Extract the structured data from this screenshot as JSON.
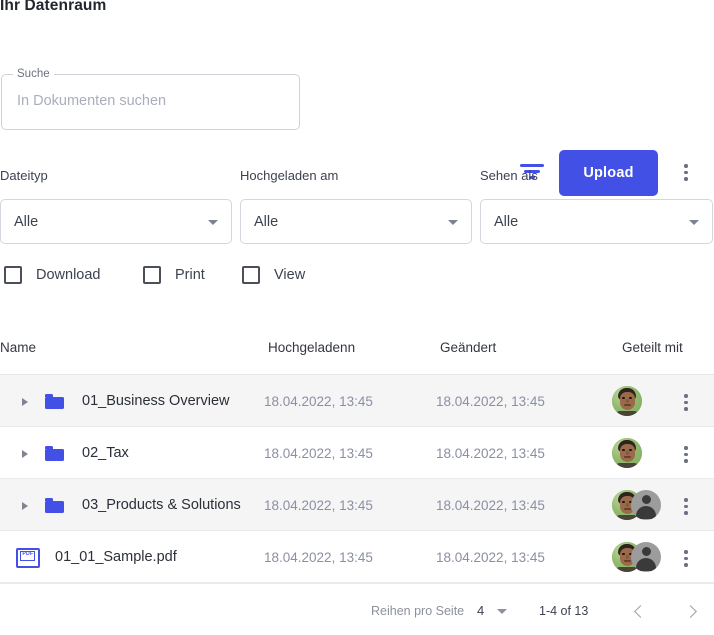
{
  "header": {
    "title": "Ihr Datenraum"
  },
  "search": {
    "label": "Suche",
    "placeholder": "In Dokumenten suchen",
    "value": ""
  },
  "toolbar": {
    "filter_icon": "filter-icon",
    "upload_label": "Upload",
    "more_icon": "kebab-menu-icon",
    "accent_color": "#4350e6"
  },
  "filters": [
    {
      "label": "Dateityp",
      "value": "Alle"
    },
    {
      "label": "Hochgeladen am",
      "value": "Alle"
    },
    {
      "label": "Sehen als",
      "value": "Alle"
    }
  ],
  "checkboxes": [
    {
      "label": "Download",
      "checked": false
    },
    {
      "label": "Print",
      "checked": false
    },
    {
      "label": "View",
      "checked": false
    }
  ],
  "table": {
    "columns": [
      "Name",
      "Hochgeladenn",
      "Geändert",
      "Geteilt mit"
    ],
    "rows": [
      {
        "name": "01_Business Overview",
        "uploaded": "18.04.2022, 13:45",
        "modified": "18.04.2022, 13:45",
        "icon": "folder-icon",
        "avatars": 1
      },
      {
        "name": "02_Tax",
        "uploaded": "18.04.2022, 13:45",
        "modified": "18.04.2022, 13:45",
        "icon": "folder-icon",
        "avatars": 1
      },
      {
        "name": "03_Products & Solutions",
        "uploaded": "18.04.2022, 13:45",
        "modified": "18.04.2022, 13:45",
        "icon": "folder-icon",
        "avatars": 2
      },
      {
        "name": "01_01_Sample.pdf",
        "uploaded": "18.04.2022, 13:45",
        "modified": "18.04.2022, 13:45",
        "icon": "pdf-icon",
        "avatars": 2
      }
    ]
  },
  "pdf_badge": "PDF",
  "footer": {
    "rows_per_page_label": "Reihen pro Seite",
    "rows_per_page_value": "4",
    "range": "1-4 of 13",
    "prev_icon": "chevron-left-icon",
    "next_icon": "chevron-right-icon"
  }
}
